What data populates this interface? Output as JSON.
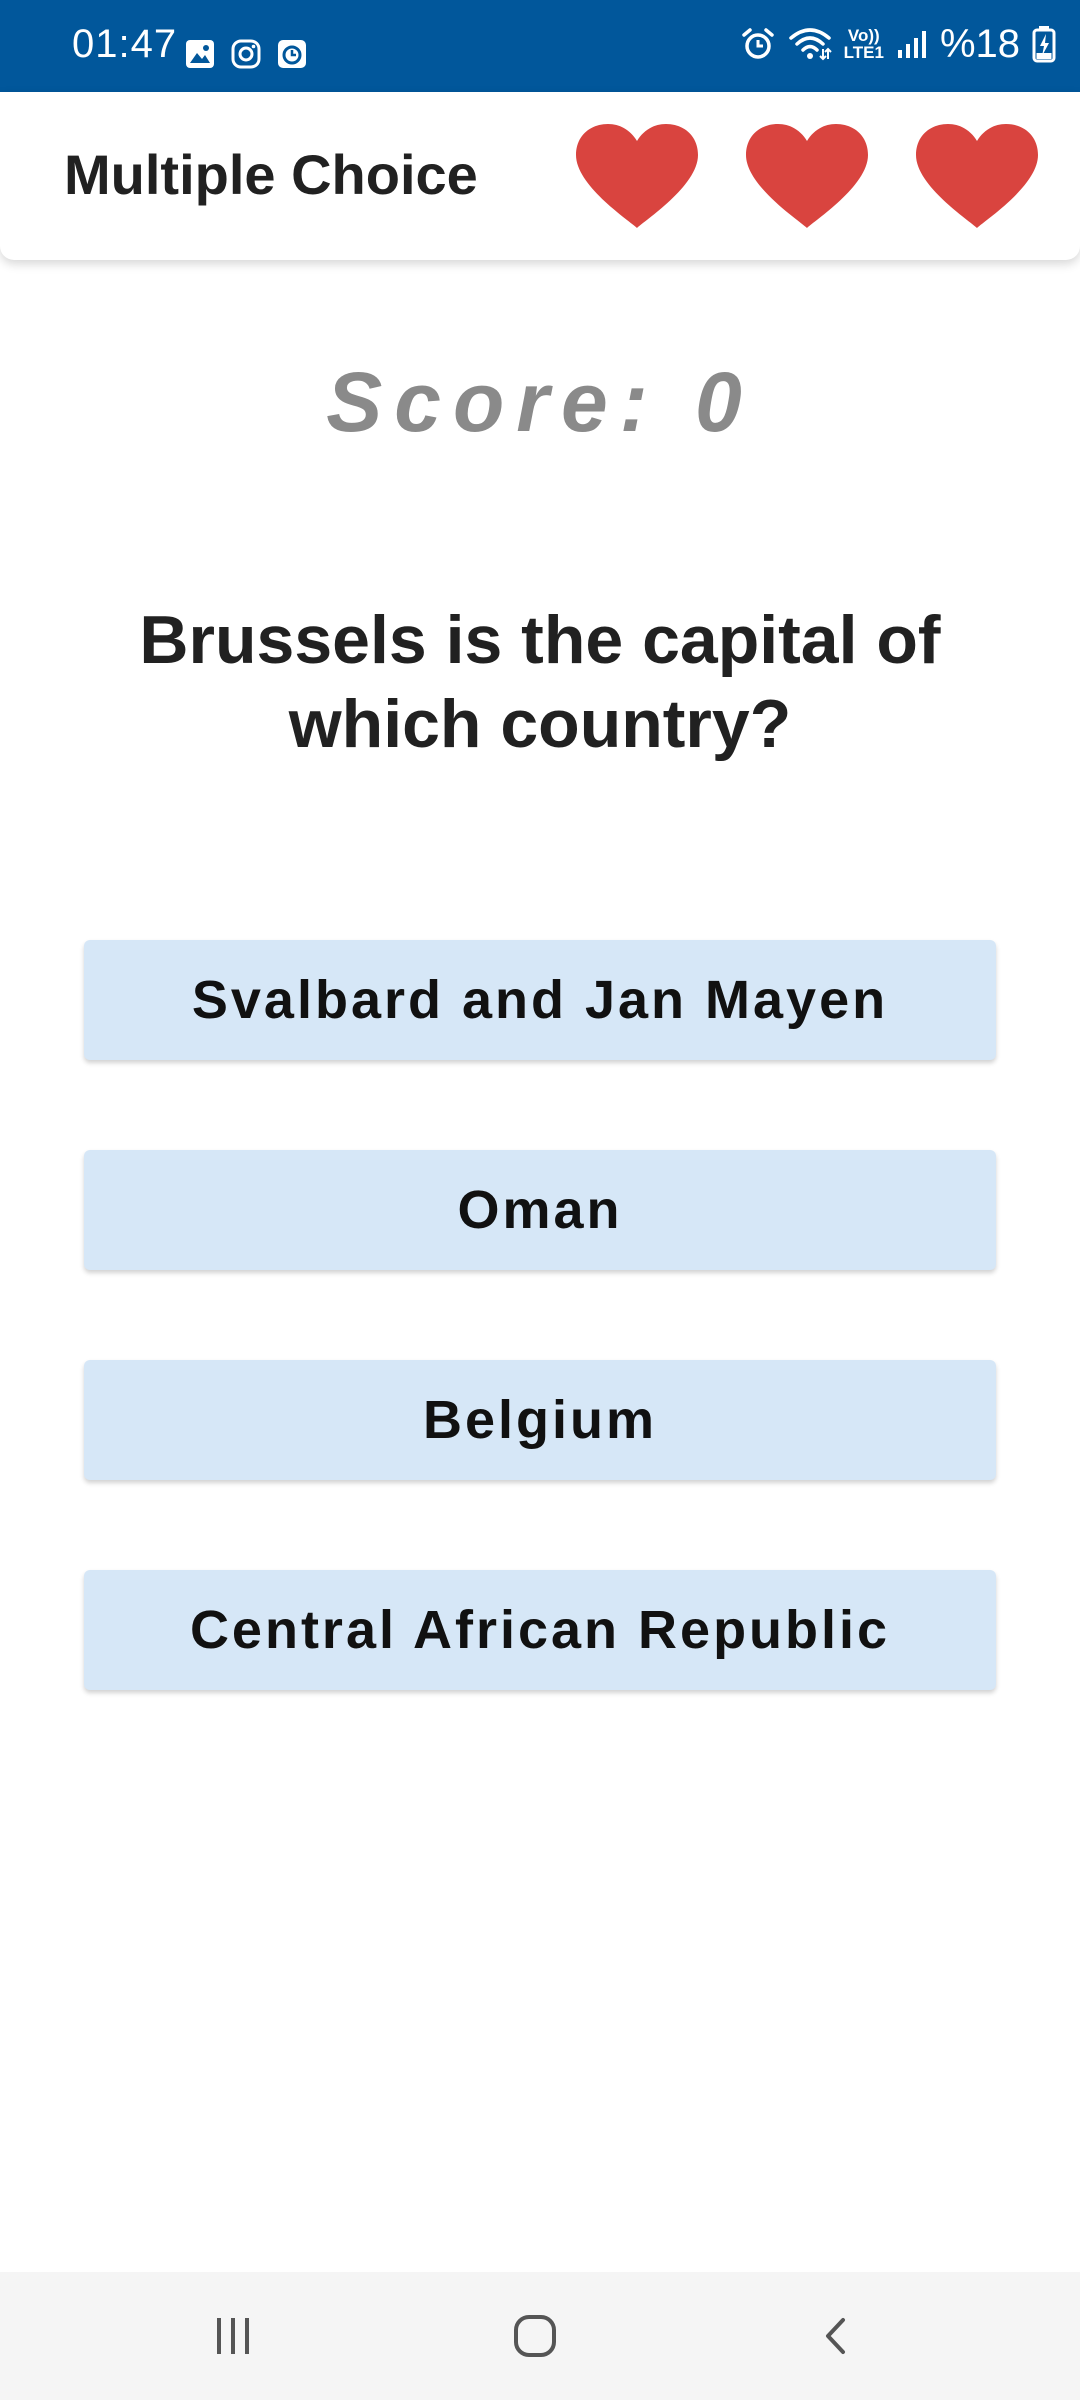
{
  "status_bar": {
    "time": "01:47",
    "battery": "%18",
    "icons": [
      "gallery-icon",
      "instagram-icon",
      "clock-app-icon",
      "alarm-icon",
      "wifi-icon",
      "volte-icon",
      "signal-icon",
      "battery-charging-icon"
    ],
    "network_label_top": "Vo))",
    "network_label_bottom": "LTE1"
  },
  "header": {
    "title": "Multiple Choice",
    "lives": 3,
    "heart_color": "#d9443f"
  },
  "score": {
    "text": "Score: 0"
  },
  "question": {
    "text": "Brussels is the capital of which country?"
  },
  "answers": [
    {
      "label": "Svalbard and Jan Mayen"
    },
    {
      "label": "Oman"
    },
    {
      "label": "Belgium"
    },
    {
      "label": "Central African Republic"
    }
  ],
  "nav_bar": {
    "icons": [
      "recents-icon",
      "home-icon",
      "back-icon"
    ]
  },
  "colors": {
    "status_bar": "#01579b",
    "answer_bg": "#d6e7f7",
    "score_text": "#8a8a8a",
    "heart": "#d9443f"
  }
}
